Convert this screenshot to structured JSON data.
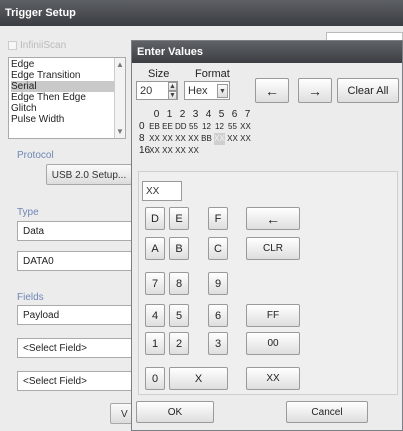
{
  "window": {
    "title": "Trigger Setup"
  },
  "infiniscan": {
    "label": "InfiniiScan"
  },
  "trigger_list": {
    "items": [
      "Edge",
      "Edge Transition",
      "Serial",
      "Edge Then Edge",
      "Glitch",
      "Pulse Width"
    ],
    "selected": "Serial"
  },
  "protocol": {
    "label": "Protocol",
    "button": "USB 2.0 Setup..."
  },
  "type": {
    "label": "Type",
    "value": "Data",
    "value2": "DATA0"
  },
  "fields": {
    "label": "Fields",
    "value": "Payload",
    "select1": "<Select Field>",
    "select2": "<Select Field>"
  },
  "partial_button": "V",
  "dialog": {
    "title": "Enter Values",
    "size_label": "Size",
    "size_value": "20",
    "format_label": "Format",
    "format_value": "Hex",
    "back_arrow": "←",
    "fwd_arrow": "→",
    "clear_all": "Clear All",
    "grid": {
      "col_headers": [
        "0",
        "1",
        "2",
        "3",
        "4",
        "5",
        "6",
        "7"
      ],
      "rows": [
        {
          "label": "0",
          "cells": [
            "EB",
            "EE",
            "DD",
            "55",
            "12",
            "12",
            "55",
            "XX"
          ]
        },
        {
          "label": "8",
          "cells": [
            "XX",
            "XX",
            "XX",
            "XX",
            "BB",
            "XX",
            "XX",
            "XX"
          ]
        },
        {
          "label": "16",
          "cells": [
            "XX",
            "XX",
            "XX",
            "XX"
          ]
        }
      ],
      "highlight": {
        "row": 1,
        "col": 5
      }
    },
    "entry_value": "XX",
    "keys": {
      "D": "D",
      "E": "E",
      "F": "F",
      "A": "A",
      "B": "B",
      "C": "C",
      "k7": "7",
      "k8": "8",
      "k9": "9",
      "k4": "4",
      "k5": "5",
      "k6": "6",
      "k1": "1",
      "k2": "2",
      "k3": "3",
      "k0": "0",
      "X": "X",
      "backspace": "←",
      "clr": "CLR",
      "ff": "FF",
      "zz": "00",
      "xx": "XX"
    },
    "ok": "OK",
    "cancel": "Cancel"
  },
  "colors": {
    "title_bar": "#4a4d51",
    "section_label": "#6f86b5",
    "highlight_cell": "#cfcfcf"
  }
}
